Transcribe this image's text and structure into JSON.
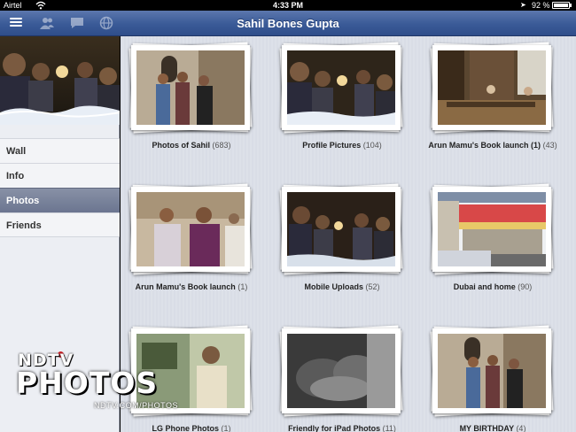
{
  "status_bar": {
    "carrier": "Airtel",
    "time": "4:33 PM",
    "battery": "92 %",
    "battery_level": 0.92
  },
  "navbar": {
    "title": "Sahil Bones Gupta",
    "icons": [
      "menu-icon",
      "friends-icon",
      "messages-icon",
      "globe-icon"
    ]
  },
  "sidebar": {
    "items": [
      {
        "label": "Wall",
        "active": false
      },
      {
        "label": "Info",
        "active": false
      },
      {
        "label": "Photos",
        "active": true
      },
      {
        "label": "Friends",
        "active": false
      }
    ]
  },
  "albums": [
    {
      "name": "Photos of Sahil",
      "count": "(683)"
    },
    {
      "name": "Profile Pictures",
      "count": "(104)"
    },
    {
      "name": "Arun Mamu's Book launch (1)",
      "count": "(43)"
    },
    {
      "name": "Arun Mamu's Book launch",
      "count": "(1)"
    },
    {
      "name": "Mobile Uploads",
      "count": "(52)"
    },
    {
      "name": "Dubai and home",
      "count": "(90)"
    },
    {
      "name": "LG Phone Photos",
      "count": "(1)"
    },
    {
      "name": "Friendly for iPad Photos",
      "count": "(11)"
    },
    {
      "name": "MY BIRTHDAY",
      "count": "(4)"
    }
  ],
  "watermark": {
    "brand": "NDTV",
    "title": "PHOTOS",
    "url": "NDTV.COM/PHOTOS"
  },
  "colors": {
    "navbar": "#3a5a97",
    "active_item": "#6b7590",
    "sidebar_bg": "#eceef3",
    "grid_bg": "#dbdfe7"
  }
}
